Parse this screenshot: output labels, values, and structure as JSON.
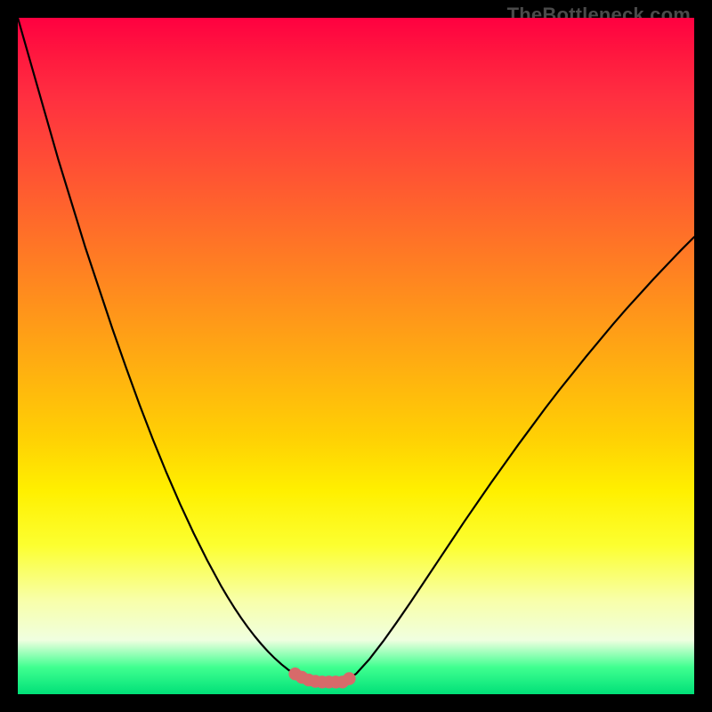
{
  "watermark": "TheBottleneck.com",
  "colors": {
    "curve": "#000000",
    "highlight_stroke": "#d76a6a",
    "highlight_fill": "#d76a6a"
  },
  "chart_data": {
    "type": "line",
    "title": "",
    "xlabel": "",
    "ylabel": "",
    "xlim": [
      0,
      100
    ],
    "ylim": [
      0,
      100
    ],
    "x": [
      0,
      2,
      4,
      6,
      8,
      10,
      12,
      14,
      16,
      18,
      20,
      22,
      24,
      26,
      28,
      30,
      31,
      32,
      33,
      34,
      35,
      36,
      37,
      38,
      39,
      40,
      41,
      42,
      43,
      44,
      46,
      48,
      50,
      52,
      54,
      56,
      58,
      60,
      62,
      64,
      66,
      68,
      70,
      72,
      74,
      76,
      78,
      80,
      82,
      84,
      86,
      88,
      90,
      92,
      94,
      96,
      98,
      100
    ],
    "y": [
      100,
      93,
      86,
      79,
      72.5,
      66,
      60,
      54,
      48.3,
      42.8,
      37.6,
      32.7,
      28.1,
      23.8,
      19.8,
      16.1,
      14.4,
      12.8,
      11.3,
      9.9,
      8.6,
      7.4,
      6.3,
      5.3,
      4.4,
      3.6,
      3.0,
      2.5,
      2.1,
      1.9,
      1.8,
      1.8,
      3.0,
      5.2,
      7.8,
      10.6,
      13.5,
      16.5,
      19.5,
      22.5,
      25.5,
      28.4,
      31.3,
      34.1,
      36.9,
      39.6,
      42.3,
      44.9,
      47.4,
      49.9,
      52.3,
      54.7,
      57.0,
      59.2,
      61.4,
      63.5,
      65.6,
      67.6
    ],
    "highlight_region": {
      "x": [
        41,
        42,
        43,
        44,
        45,
        46,
        47,
        48,
        49
      ],
      "y": [
        3.0,
        2.5,
        2.1,
        1.9,
        1.8,
        1.8,
        1.8,
        1.8,
        2.3
      ],
      "marker_radius_pct": 0.95,
      "stroke_width_pct": 1.6
    }
  }
}
